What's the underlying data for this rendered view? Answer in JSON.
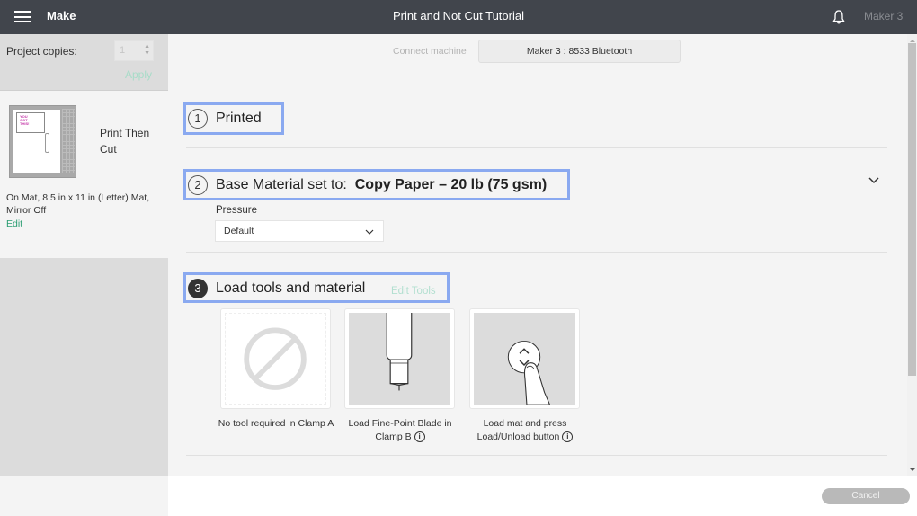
{
  "header": {
    "app_name": "Make",
    "title": "Print and Not Cut Tutorial",
    "machine_name": "Maker 3",
    "icons": {
      "menu": "hamburger-icon",
      "notifications": "bell-icon"
    }
  },
  "sidebar": {
    "copies_label": "Project copies:",
    "copies_value": "1",
    "apply_label": "Apply",
    "mat": {
      "title": "Print Then Cut",
      "design_text": "YOU GOT THIS!",
      "info": "On Mat, 8.5 in x 11 in (Letter) Mat, Mirror Off",
      "edit_label": "Edit"
    }
  },
  "connect": {
    "label": "Connect machine",
    "device": "Maker 3 : 8533 Bluetooth"
  },
  "steps": [
    {
      "number": "1",
      "title": "Printed"
    },
    {
      "number": "2",
      "title": "Base Material set to:",
      "value": "Copy Paper – 20 lb (75 gsm)",
      "pressure_label": "Pressure",
      "pressure_value": "Default"
    },
    {
      "number": "3",
      "title": "Load tools and material",
      "edit_tools_label": "Edit Tools",
      "tools": [
        {
          "caption": "No tool required in Clamp A",
          "icon": "no-tool-icon",
          "info": false
        },
        {
          "caption": "Load Fine-Point Blade in Clamp B",
          "icon": "fine-point-blade-icon",
          "info": true
        },
        {
          "caption": "Load mat and press Load/Unload button",
          "icon": "load-unload-button-icon",
          "info": true
        }
      ]
    }
  ],
  "footer": {
    "cancel_label": "Cancel"
  },
  "colors": {
    "header_bg": "#41454c",
    "accent_green": "#2a9d72",
    "highlight_blue": "#8aa9f0"
  }
}
